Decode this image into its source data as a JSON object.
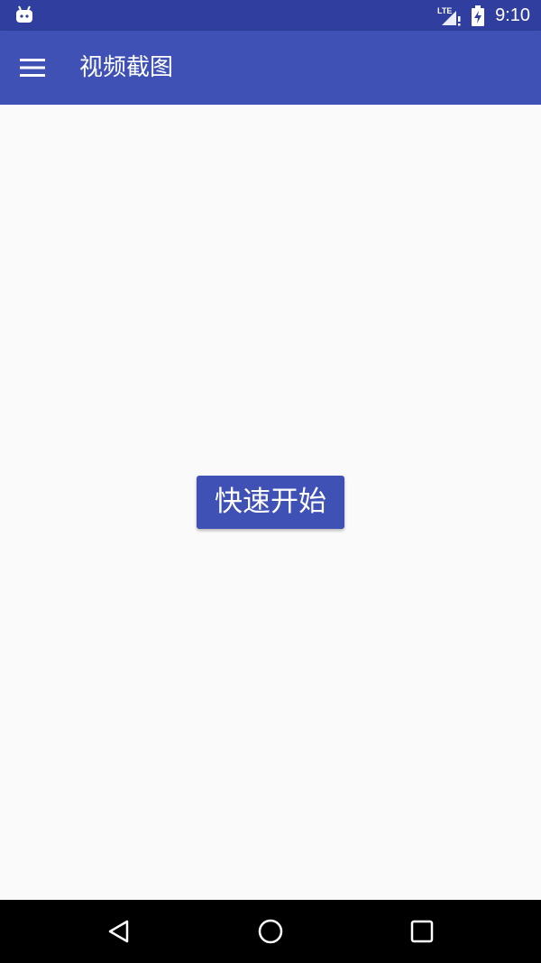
{
  "status_bar": {
    "time": "9:10",
    "network": "LTE",
    "icons": [
      "android-icon",
      "signal-icon",
      "battery-icon"
    ]
  },
  "app_bar": {
    "title": "视频截图",
    "menu_icon": "hamburger-menu-icon"
  },
  "main": {
    "start_button_label": "快速开始"
  },
  "nav_bar": {
    "buttons": [
      "back-icon",
      "home-icon",
      "recents-icon"
    ]
  },
  "colors": {
    "status_bar": "#303f9f",
    "primary": "#3f51b5",
    "background": "#fafafa",
    "nav_bar": "#000000"
  }
}
